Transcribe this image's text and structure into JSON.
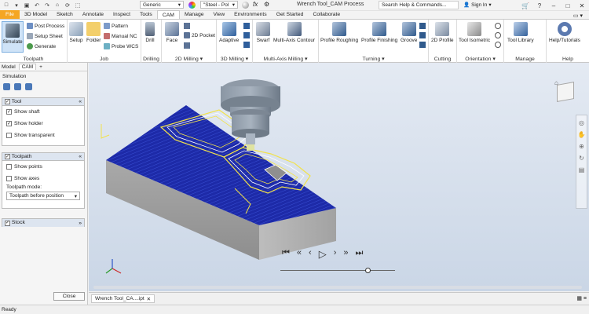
{
  "titlebar": {
    "preset": "Generic",
    "material": "\"Steel - Pol",
    "document_title": "Wrench Tool_CAM Process",
    "search_placeholder": "Search Help & Commands...",
    "signin": "Sign In"
  },
  "tabs": [
    "File",
    "3D Model",
    "Sketch",
    "Annotate",
    "Inspect",
    "Tools",
    "CAM",
    "Manage",
    "View",
    "Environments",
    "Get Started",
    "Collaborate"
  ],
  "ribbon": {
    "toolpath": {
      "simulate": "Simulate",
      "post_process": "Post Process",
      "setup_sheet": "Setup Sheet",
      "generate": "Generate",
      "title": "Toolpath"
    },
    "job": {
      "setup": "Setup",
      "folder": "Folder",
      "pattern": "Pattern",
      "manual_nc": "Manual NC",
      "probe_wcs": "Probe WCS",
      "title": "Job"
    },
    "drilling": {
      "drill": "Drill",
      "title": "Drilling"
    },
    "milling_2d": {
      "face": "Face",
      "pocket": "2D Pocket",
      "title": "2D Milling"
    },
    "milling_3d": {
      "adaptive": "Adaptive",
      "title": "3D Milling"
    },
    "multi_axis": {
      "swarf": "Swarf",
      "contour": "Multi-Axis Contour",
      "title": "Multi-Axis Milling"
    },
    "turning": {
      "roughing": "Profile Roughing",
      "finishing": "Profile Finishing",
      "groove": "Groove",
      "title": "Turning"
    },
    "cutting": {
      "profile": "2D Profile",
      "title": "Cutting"
    },
    "orientation": {
      "tool_isometric": "Tool Isometric",
      "title": "Orientation"
    },
    "manage": {
      "tool_library": "Tool Library",
      "title": "Manage"
    },
    "help": {
      "tutorials": "Help/Tutorials",
      "title": "Help"
    }
  },
  "left_panel": {
    "tab_model": "Model",
    "tab_cam": "CAM",
    "tab_add": "+",
    "heading": "Simulation",
    "tool_section": {
      "title": "Tool",
      "show_shaft": "Show shaft",
      "show_holder": "Show holder",
      "show_transparent": "Show transparent"
    },
    "toolpath_section": {
      "title": "Toolpath",
      "show_points": "Show points",
      "show_axes": "Show axes",
      "mode_label": "Toolpath mode:",
      "mode_value": "Toolpath before position"
    },
    "stock_section": {
      "title": "Stock"
    },
    "close": "Close"
  },
  "document_tab": "Wrench Tool_CA....ipt",
  "status": "Ready",
  "colors": {
    "accent": "#f5a623",
    "toolpath": "#1b2fb0",
    "highlight": "#f2e24a"
  }
}
